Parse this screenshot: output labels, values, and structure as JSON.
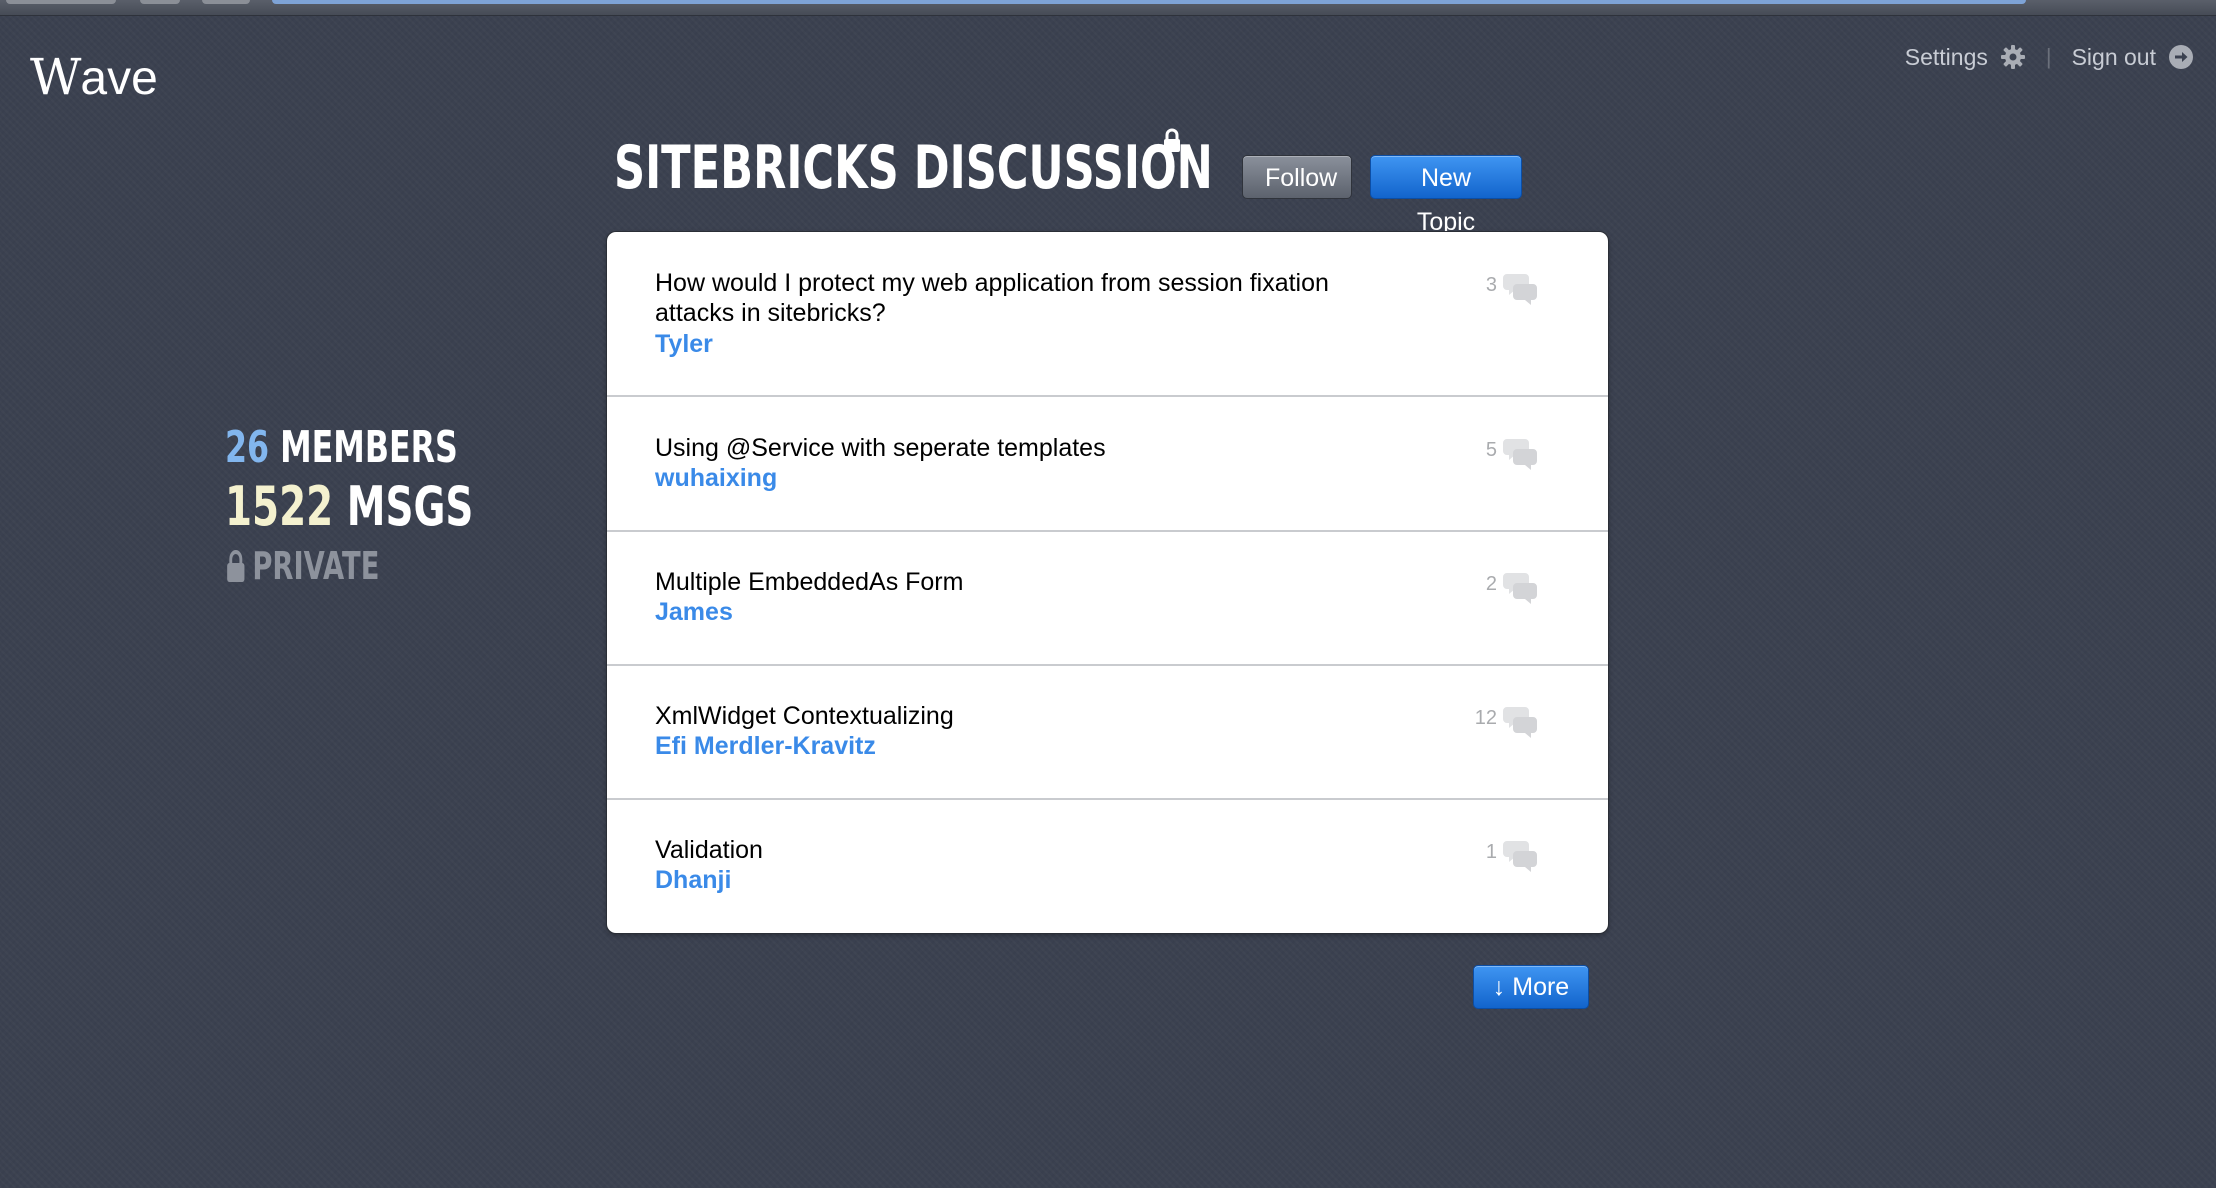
{
  "app": {
    "logo_initial": "W",
    "logo_rest": "ave"
  },
  "nav": {
    "settings_label": "Settings",
    "signout_label": "Sign out",
    "separator": "|"
  },
  "group": {
    "title": "SITEBRICKS DISCUSSION",
    "follow_label": "Follow",
    "new_topic_label": "New Topic"
  },
  "stats": {
    "members_count": "26",
    "members_label": "MEMBERS",
    "msgs_count": "1522",
    "msgs_label": "MSGS",
    "private_label": "PRIVATE"
  },
  "topics": [
    {
      "title": "How would I protect my web application from session fixation attacks in sitebricks?",
      "author": "Tyler",
      "count": "3"
    },
    {
      "title": "Using @Service with seperate templates",
      "author": "wuhaixing",
      "count": "5"
    },
    {
      "title": "Multiple EmbeddedAs Form",
      "author": "James",
      "count": "2"
    },
    {
      "title": "XmlWidget Contextualizing",
      "author": "Efi Merdler-Kravitz",
      "count": "12"
    },
    {
      "title": "Validation",
      "author": "Dhanji",
      "count": "1"
    }
  ],
  "pager": {
    "more_label": "↓ More"
  },
  "colors": {
    "background": "#3b4150",
    "accent_blue": "#1b74dd",
    "author_blue": "#3a8ae8",
    "members_blue": "#82b6ee",
    "msgs_cream": "#f4f1cf"
  }
}
